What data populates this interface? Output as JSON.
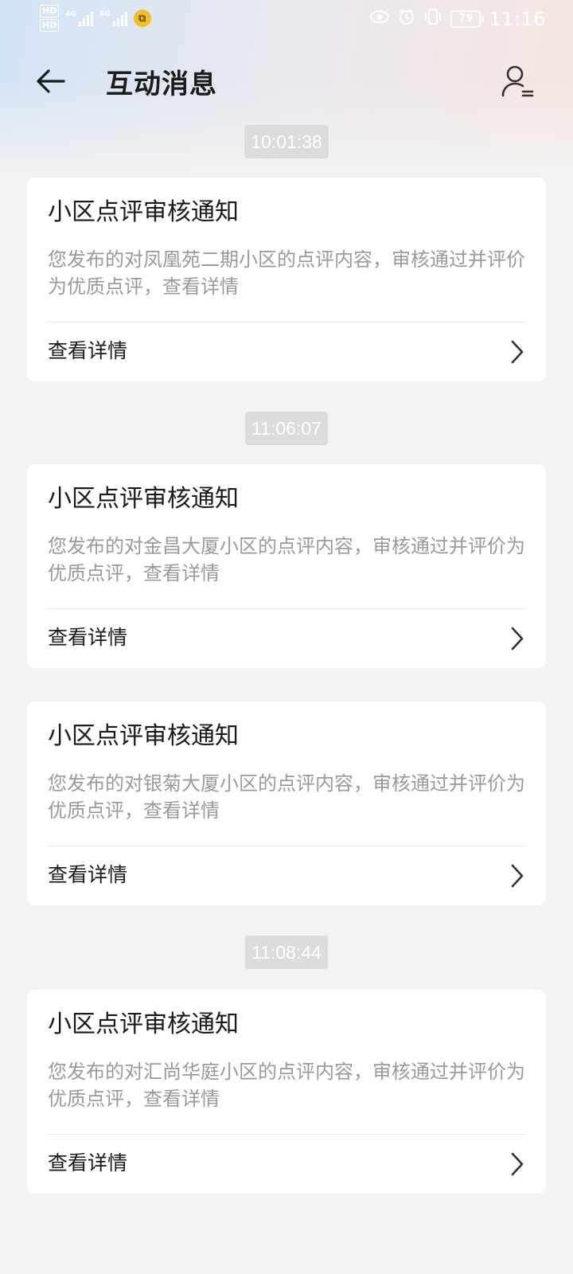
{
  "status_bar": {
    "hd1": "HD",
    "hd2": "HD",
    "net1": "4G",
    "net2": "4G",
    "battery": "79",
    "time": "11:16"
  },
  "header": {
    "title": "互动消息",
    "back_icon": "arrow-left-icon",
    "profile_icon": "user-settings-icon"
  },
  "groups": [
    {
      "time": "10:01:38",
      "cards": [
        {
          "title": "小区点评审核通知",
          "body": "您发布的对凤凰苑二期小区的点评内容，审核通过并评价为优质点评，查看详情",
          "link": "查看详情"
        }
      ]
    },
    {
      "time": "11:06:07",
      "cards": [
        {
          "title": "小区点评审核通知",
          "body": "您发布的对金昌大厦小区的点评内容，审核通过并评价为优质点评，查看详情",
          "link": "查看详情"
        },
        {
          "title": "小区点评审核通知",
          "body": "您发布的对银菊大厦小区的点评内容，审核通过并评价为优质点评，查看详情",
          "link": "查看详情"
        }
      ]
    },
    {
      "time": "11:08:44",
      "cards": [
        {
          "title": "小区点评审核通知",
          "body": "您发布的对汇尚华庭小区的点评内容，审核通过并评价为优质点评，查看详情",
          "link": "查看详情"
        }
      ]
    }
  ]
}
